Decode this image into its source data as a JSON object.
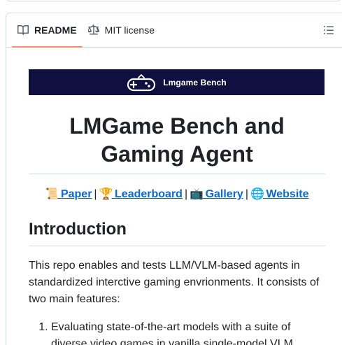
{
  "tabs": [
    {
      "label": "README",
      "icon": "book-icon",
      "active": true
    },
    {
      "label": "MIT license",
      "icon": "scale-icon",
      "active": false
    }
  ],
  "outline_icon": "list-unordered-icon",
  "banner": {
    "text": "Lmgame Bench",
    "icon": "gamepad-icon",
    "background": "#0f0f40"
  },
  "title": "LMGame Bench and Gaming Agent",
  "links": [
    {
      "emoji": "📜",
      "label": "Paper"
    },
    {
      "emoji": "🏆",
      "label": "Leaderboard"
    },
    {
      "emoji": "📺",
      "label": "Gallery"
    },
    {
      "emoji": "🌐",
      "label": "Website"
    }
  ],
  "link_separator": "|",
  "section_heading": "Introduction",
  "intro_paragraph": "This repo enables and tests LLM/VLM-based agents in standardized interctive gaming envrionments. It consists of two main features:",
  "features": [
    "Evaluating state-of-the-art models with a suite of diverse video games in vanilla single-model VLM"
  ],
  "colors": {
    "link": "#0969da",
    "active_tab_underline": "#fd8c73",
    "border": "#d1d9e0"
  }
}
